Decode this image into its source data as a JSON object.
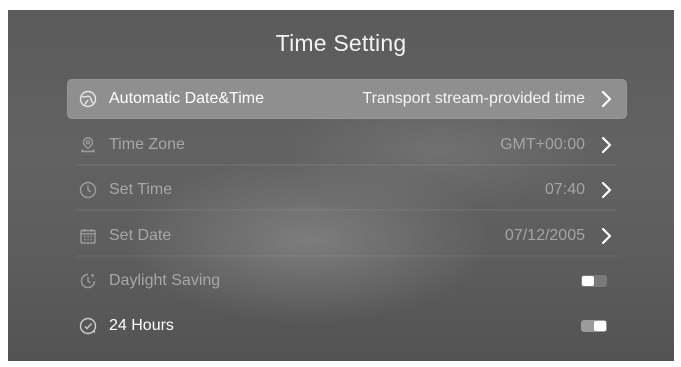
{
  "screen": {
    "title": "Time Setting"
  },
  "rows": [
    {
      "label": "Automatic Date&Time",
      "value": "Transport stream-provided time",
      "icon": "clock-globe-icon",
      "state": "focused"
    },
    {
      "label": "Time Zone",
      "value": "GMT+00:00",
      "icon": "location-pin-icon",
      "state": "disabled"
    },
    {
      "label": "Set Time",
      "value": "07:40",
      "icon": "clock-icon",
      "state": "disabled"
    },
    {
      "label": "Set Date",
      "value": "07/12/2005",
      "icon": "calendar-icon",
      "state": "disabled"
    },
    {
      "label": "Daylight Saving",
      "toggle": "off",
      "icon": "daylight-clock-icon",
      "state": "disabled"
    },
    {
      "label": "24 Hours",
      "toggle": "on",
      "icon": "24h-clock-icon",
      "state": "enabled"
    }
  ],
  "colors": {
    "background": "#5e5e5e",
    "focus_row": "#8f8f8f",
    "text_primary": "#ffffff",
    "text_dim": "#a7a7a7"
  }
}
